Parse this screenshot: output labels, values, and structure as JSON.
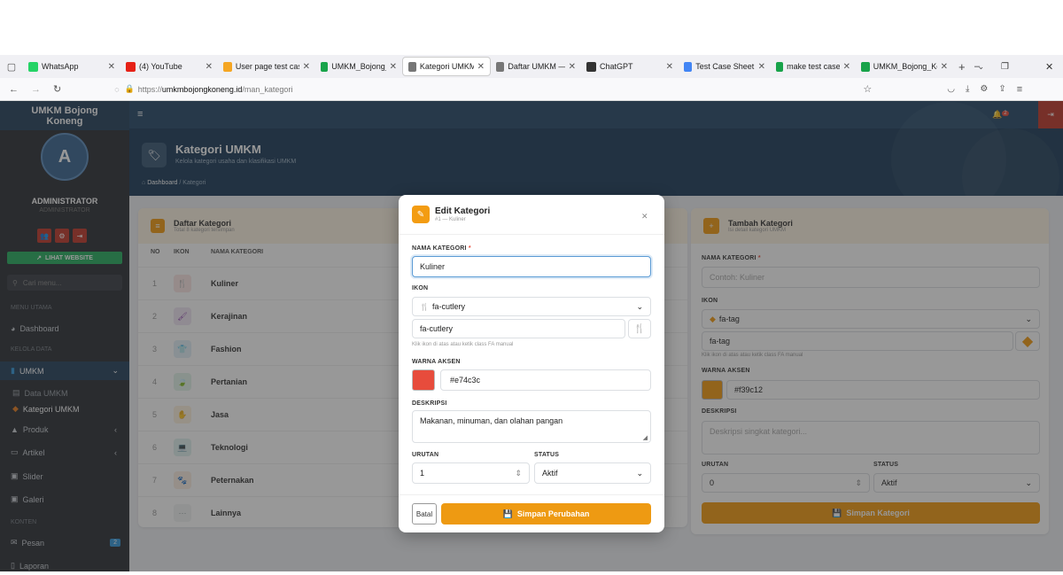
{
  "browser": {
    "tabs": [
      {
        "label": "WhatsApp",
        "icon": "whatsapp-icon",
        "color": "#25d366"
      },
      {
        "label": "(4) YouTube",
        "icon": "youtube-icon",
        "color": "#e62117"
      },
      {
        "label": "User page test case",
        "icon": "sun-icon",
        "color": "#f5a623"
      },
      {
        "label": "UMKM_Bojong_Kon",
        "icon": "sheets-icon",
        "color": "#18a34a"
      },
      {
        "label": "Kategori UMKM —",
        "icon": "store-icon",
        "color": "#777777",
        "active": true
      },
      {
        "label": "Daftar UMKM — U",
        "icon": "store-icon",
        "color": "#777777"
      },
      {
        "label": "ChatGPT",
        "icon": "chatgpt-icon",
        "color": "#333333"
      },
      {
        "label": "Test Case Sheet for",
        "icon": "gemini-icon",
        "color": "#4285f4"
      },
      {
        "label": "make test case both",
        "icon": "sheets-icon",
        "color": "#18a34a"
      },
      {
        "label": "UMKM_Bojong_Kon",
        "icon": "sheets-icon",
        "color": "#18a34a"
      }
    ],
    "url_prefix": "https://",
    "url_domain": "umkmbojongkoneng.id",
    "url_path": "/man_kategori"
  },
  "sidebar": {
    "brand": "UMKM Bojong Koneng",
    "avatar_letter": "A",
    "user_name": "ADMINISTRATOR",
    "user_role": "ADMINISTRATOR",
    "visit_button": "LIHAT WEBSITE",
    "search_placeholder": "Cari menu...",
    "section_main": "MENU UTAMA",
    "dashboard": "Dashboard",
    "section_data": "KELOLA DATA",
    "umkm": "UMKM",
    "data_umkm": "Data UMKM",
    "kategori_umkm": "Kategori UMKM",
    "produk": "Produk",
    "artikel": "Artikel",
    "slider": "Slider",
    "galeri": "Galeri",
    "section_content": "KONTEN",
    "pesan": "Pesan",
    "pesan_badge": "2",
    "laporan": "Laporan"
  },
  "topbar": {
    "notif_count": "2"
  },
  "header": {
    "title": "Kategori UMKM",
    "subtitle": "Kelola kategori usaha dan klasifikasi UMKM",
    "crumb_home": "Dashboard",
    "crumb_sep": "/",
    "crumb_current": "Kategori"
  },
  "list_card": {
    "title": "Daftar Kategori",
    "subtitle": "Total 8 kategori tersimpan",
    "col_no": "NO",
    "col_icon": "IKON",
    "col_name": "NAMA KATEGORI",
    "rows": [
      {
        "no": "1",
        "name": "Kuliner",
        "icon": "utensils-icon",
        "color": "#e74c3c",
        "glyph": "🍴"
      },
      {
        "no": "2",
        "name": "Kerajinan",
        "icon": "brush-icon",
        "color": "#8e44ad",
        "glyph": "🖌"
      },
      {
        "no": "3",
        "name": "Fashion",
        "icon": "shirt-icon",
        "color": "#2e86c1",
        "glyph": "👕"
      },
      {
        "no": "4",
        "name": "Pertanian",
        "icon": "leaf-icon",
        "color": "#27ae60",
        "glyph": "🍃"
      },
      {
        "no": "5",
        "name": "Jasa",
        "icon": "hand-icon",
        "color": "#f39c12",
        "glyph": "✋"
      },
      {
        "no": "6",
        "name": "Teknologi",
        "icon": "laptop-icon",
        "color": "#16a085",
        "glyph": "💻"
      },
      {
        "no": "7",
        "name": "Peternakan",
        "icon": "paw-icon",
        "color": "#e67e22",
        "glyph": "🐾"
      },
      {
        "no": "8",
        "name": "Lainnya",
        "icon": "ellipsis-icon",
        "color": "#95a5a6",
        "glyph": "⋯"
      }
    ]
  },
  "add_card": {
    "title": "Tambah Kategori",
    "subtitle": "Isi detail kategori UMKM",
    "name_label": "NAMA KATEGORI",
    "name_placeholder": "Contoh: Kuliner",
    "icon_label": "IKON",
    "icon_selected": "fa-tag",
    "icon_value": "fa-tag",
    "icon_hint": "Klik ikon di atas atau ketik class FA manual",
    "color_label": "WARNA AKSEN",
    "color_value": "#f39c12",
    "desc_label": "DESKRIPSI",
    "desc_placeholder": "Deskripsi singkat kategori...",
    "order_label": "URUTAN",
    "order_value": "0",
    "status_label": "STATUS",
    "status_value": "Aktif",
    "submit": "Simpan Kategori"
  },
  "modal": {
    "title": "Edit Kategori",
    "subtitle": "#1 — Kuliner",
    "name_label": "NAMA KATEGORI",
    "required_mark": "*",
    "name_value": "Kuliner",
    "icon_label": "IKON",
    "icon_selected": "fa-cutlery",
    "icon_value": "fa-cutlery",
    "icon_hint": "Klik ikon di atas atau ketik class FA manual",
    "color_label": "WARNA AKSEN",
    "color_value": "#e74c3c",
    "desc_label": "DESKRIPSI",
    "desc_value": "Makanan, minuman, dan olahan pangan",
    "order_label": "URUTAN",
    "order_value": "1",
    "status_label": "STATUS",
    "status_value": "Aktif",
    "cancel": "Batal",
    "save": "Simpan Perubahan"
  }
}
